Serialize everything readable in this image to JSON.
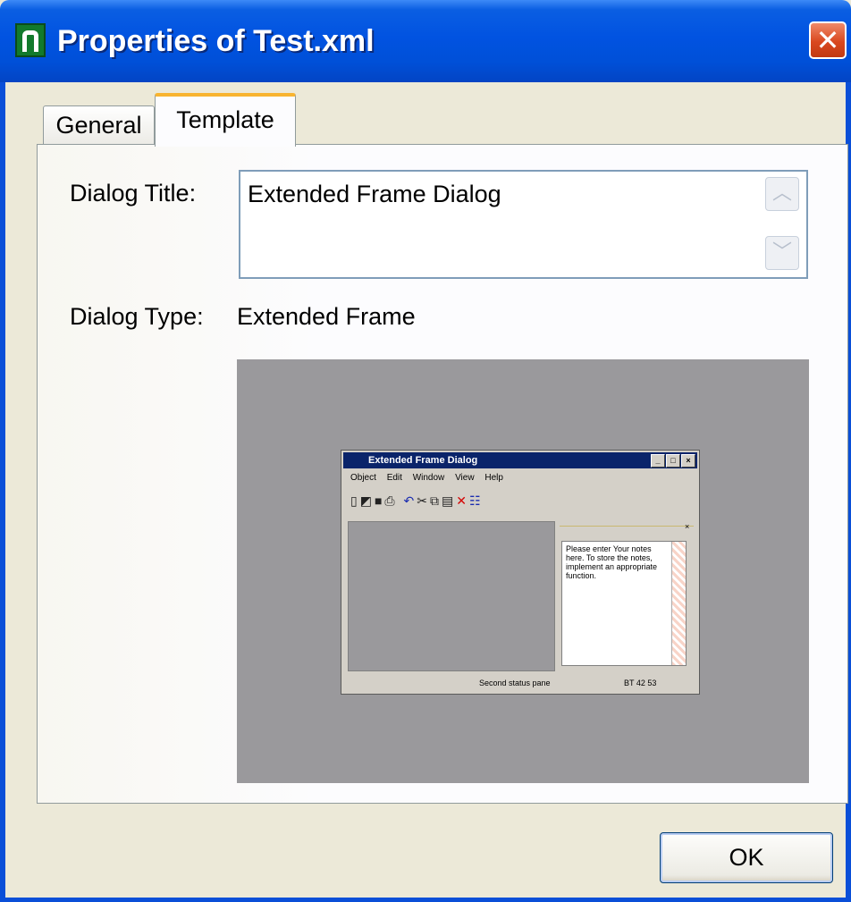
{
  "window": {
    "title": "Properties of Test.xml",
    "close_glyph": "✕",
    "icon": "app-n-icon"
  },
  "tabs": [
    {
      "label": "General",
      "active": false
    },
    {
      "label": "Template",
      "active": true
    }
  ],
  "form": {
    "dialog_title_label": "Dialog Title:",
    "dialog_title_value": "Extended Frame Dialog",
    "dialog_type_label": "Dialog Type:",
    "dialog_type_value": "Extended Frame",
    "scroll_up_glyph": "︿",
    "scroll_down_glyph": "﹀"
  },
  "preview": {
    "title": "Extended Frame Dialog",
    "controls": [
      "_",
      "□",
      "×"
    ],
    "menu": [
      "Object",
      "Edit",
      "Window",
      "View",
      "Help"
    ],
    "toolbar": [
      "new-icon",
      "open-icon",
      "save-icon",
      "print-icon",
      "undo-icon",
      "cut-icon",
      "copy-icon",
      "paste-icon",
      "delete-icon",
      "properties-icon"
    ],
    "notes_text": "Please enter Your notes here. To store the notes, implement an appropriate function.",
    "status_pane_2": "Second status pane",
    "status_pane_3": "BT 42 53"
  },
  "buttons": {
    "ok_label": "OK"
  },
  "colors": {
    "titlebar": "#0153e1",
    "tab_accent": "#f8b430",
    "preview_background": "#9a999c"
  }
}
